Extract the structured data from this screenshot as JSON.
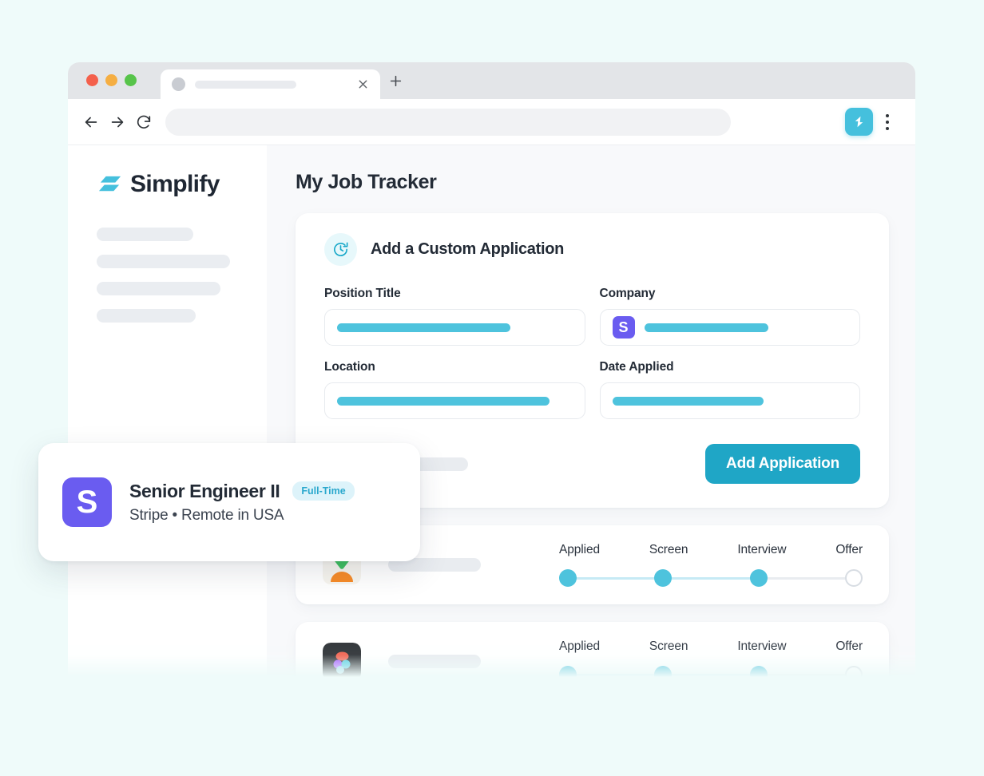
{
  "browser": {
    "traffic_lights": [
      "close",
      "minimize",
      "maximize"
    ],
    "tab": {
      "title": "",
      "close_label": "×"
    },
    "new_tab_label": "+",
    "nav": {
      "back": "back-arrow",
      "forward": "forward-arrow",
      "reload": "reload"
    },
    "address_bar_value": "",
    "extension_icon": "simplify-extension-icon",
    "menu_icon": "kebab-menu-icon"
  },
  "sidebar": {
    "brand": {
      "name": "Simplify",
      "mark": "simplify-logo-mark"
    },
    "skeleton_widths": [
      121,
      167,
      155,
      124
    ]
  },
  "main": {
    "page_title": "My Job Tracker",
    "add_card": {
      "icon": "history-clock-icon",
      "title": "Add a Custom Application",
      "fields": [
        {
          "label": "Position Title",
          "value_bar_width": 217,
          "logo": null
        },
        {
          "label": "Company",
          "value_bar_width": 155,
          "logo": "S"
        },
        {
          "label": "Location",
          "value_bar_width": 266,
          "logo": null
        },
        {
          "label": "Date Applied",
          "value_bar_width": 189,
          "logo": null
        }
      ],
      "submit_label": "Add Application"
    },
    "applications": [
      {
        "logo": "instacart-carrot-icon",
        "title_skeleton_width": 116,
        "stages": [
          "Applied",
          "Screen",
          "Interview",
          "Offer"
        ],
        "completed": 3
      },
      {
        "logo": "figma-icon",
        "title_skeleton_width": 116,
        "stages": [
          "Applied",
          "Screen",
          "Interview",
          "Offer"
        ],
        "completed": 3
      }
    ]
  },
  "job_popup": {
    "logo_letter": "S",
    "title": "Senior Engineer II",
    "badge": "Full-Time",
    "subtitle": "Stripe • Remote in USA"
  },
  "colors": {
    "brand_cyan": "#4ec3dd",
    "button_cyan": "#1fa6c6",
    "accent_purple": "#6a5cf0",
    "page_bg": "#effbfa",
    "main_bg": "#f8f9fb",
    "badge_bg": "#ddf3fa",
    "badge_text": "#2aa8cd"
  }
}
